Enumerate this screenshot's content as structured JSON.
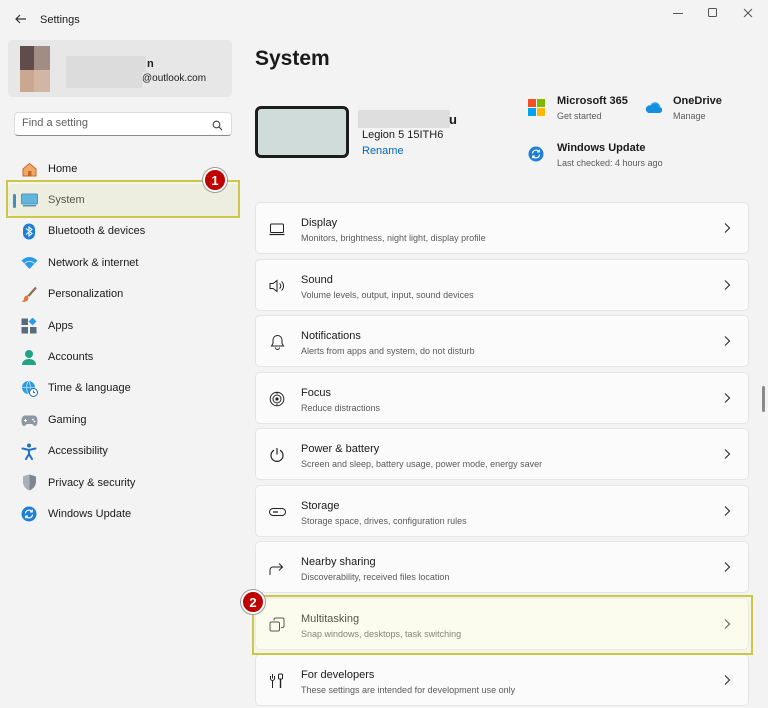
{
  "window": {
    "title": "Settings"
  },
  "profile": {
    "name_tail": "n",
    "email_tail": "@outlook.com"
  },
  "search": {
    "placeholder": "Find a setting"
  },
  "sidebar": {
    "items": [
      {
        "label": "Home",
        "icon": "home-icon"
      },
      {
        "label": "System",
        "icon": "monitor-icon",
        "selected": true
      },
      {
        "label": "Bluetooth & devices",
        "icon": "bluetooth-icon"
      },
      {
        "label": "Network & internet",
        "icon": "wifi-icon"
      },
      {
        "label": "Personalization",
        "icon": "brush-icon"
      },
      {
        "label": "Apps",
        "icon": "apps-icon"
      },
      {
        "label": "Accounts",
        "icon": "person-icon"
      },
      {
        "label": "Time & language",
        "icon": "globe-clock-icon"
      },
      {
        "label": "Gaming",
        "icon": "gamepad-icon"
      },
      {
        "label": "Accessibility",
        "icon": "accessibility-icon"
      },
      {
        "label": "Privacy & security",
        "icon": "shield-icon"
      },
      {
        "label": "Windows Update",
        "icon": "update-icon"
      }
    ]
  },
  "main": {
    "title": "System",
    "device": {
      "name_tail": "u",
      "model": "Legion 5 15ITH6",
      "rename_label": "Rename"
    },
    "quick_links": [
      {
        "title": "Microsoft 365",
        "subtitle": "Get started",
        "icon": "microsoft-logo-icon"
      },
      {
        "title": "OneDrive",
        "subtitle": "Manage",
        "icon": "onedrive-cloud-icon"
      },
      {
        "title": "Windows Update",
        "subtitle": "Last checked: 4 hours ago",
        "icon": "windows-update-icon"
      }
    ],
    "cards": [
      {
        "title": "Display",
        "subtitle": "Monitors, brightness, night light, display profile",
        "icon": "display-icon"
      },
      {
        "title": "Sound",
        "subtitle": "Volume levels, output, input, sound devices",
        "icon": "speaker-icon"
      },
      {
        "title": "Notifications",
        "subtitle": "Alerts from apps and system, do not disturb",
        "icon": "bell-icon"
      },
      {
        "title": "Focus",
        "subtitle": "Reduce distractions",
        "icon": "focus-icon"
      },
      {
        "title": "Power & battery",
        "subtitle": "Screen and sleep, battery usage, power mode, energy saver",
        "icon": "power-icon"
      },
      {
        "title": "Storage",
        "subtitle": "Storage space, drives, configuration rules",
        "icon": "storage-icon"
      },
      {
        "title": "Nearby sharing",
        "subtitle": "Discoverability, received files location",
        "icon": "nearby-sharing-icon"
      },
      {
        "title": "Multitasking",
        "subtitle": "Snap windows, desktops, task switching",
        "icon": "multitasking-icon"
      },
      {
        "title": "For developers",
        "subtitle": "These settings are intended for development use only",
        "icon": "developer-tools-icon"
      }
    ]
  },
  "annotations": {
    "step1": "1",
    "step2": "2",
    "highlight_color": "#ccc64a",
    "badge_color": "#c00000"
  },
  "colors": {
    "accent": "#0067c0"
  }
}
